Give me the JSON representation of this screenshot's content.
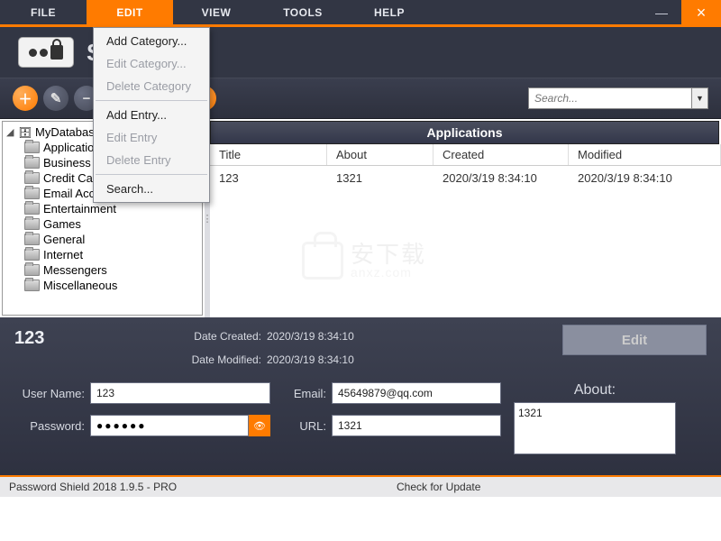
{
  "menu": {
    "file": "FILE",
    "edit": "EDIT",
    "view": "VIEW",
    "tools": "TOOLS",
    "help": "HELP"
  },
  "window": {
    "min": "—",
    "close": "×"
  },
  "app_title": "Shield",
  "toolbar": {
    "search_placeholder": "Search..."
  },
  "dropdown": {
    "add_category": "Add Category...",
    "edit_category": "Edit Category...",
    "delete_category": "Delete Category",
    "add_entry": "Add Entry...",
    "edit_entry": "Edit Entry",
    "delete_entry": "Delete Entry",
    "search": "Search..."
  },
  "tree": {
    "root": "MyDatabas",
    "items": [
      "Applications",
      "Business",
      "Credit Cards",
      "Email Accounts",
      "Entertainment",
      "Games",
      "General",
      "Internet",
      "Messengers",
      "Miscellaneous"
    ]
  },
  "category_header": "Applications",
  "table": {
    "cols": {
      "title": "Title",
      "about": "About",
      "created": "Created",
      "modified": "Modified"
    },
    "rows": [
      {
        "title": "123",
        "about": "1321",
        "created": "2020/3/19 8:34:10",
        "modified": "2020/3/19 8:34:10"
      }
    ]
  },
  "detail": {
    "title": "123",
    "date_created_label": "Date Created:",
    "date_created": "2020/3/19 8:34:10",
    "date_modified_label": "Date Modified:",
    "date_modified": "2020/3/19 8:34:10",
    "edit": "Edit",
    "username_label": "User Name:",
    "username": "123",
    "password_label": "Password:",
    "password": "●●●●●●",
    "email_label": "Email:",
    "email": "45649879@qq.com",
    "url_label": "URL:",
    "url": "1321",
    "about_label": "About:",
    "about": "1321"
  },
  "status": {
    "left": "Password Shield 2018 1.9.5 - PRO",
    "right": "Check for Update"
  },
  "watermark": {
    "cn": "安下载",
    "en": "anxz.com"
  }
}
